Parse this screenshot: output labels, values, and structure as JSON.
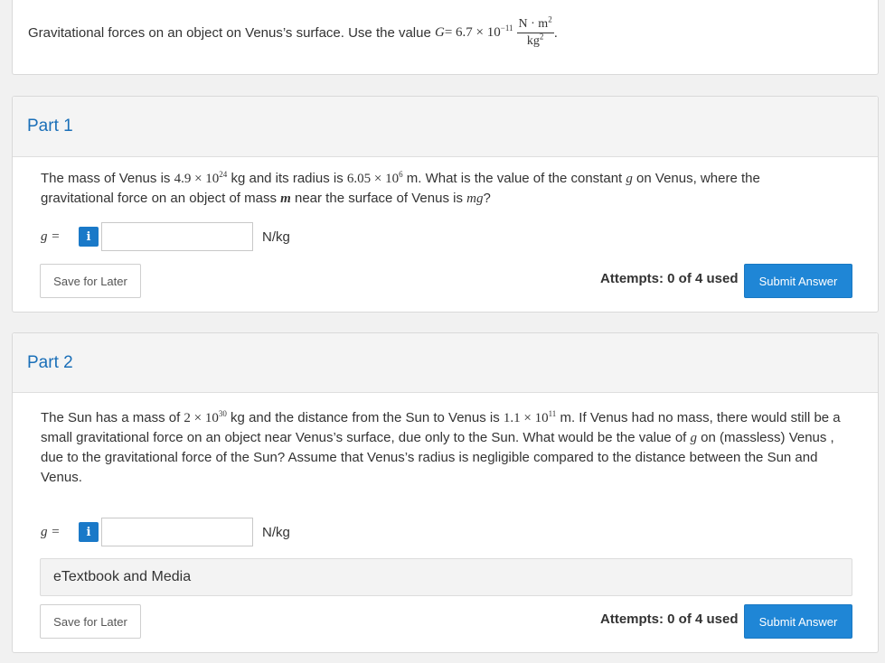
{
  "intro": {
    "text": "Gravitational forces on an object on Venus’s surface. Use the value",
    "G_symbol": "G",
    "equals": " = 6.7 × 10",
    "exp": "−11",
    "unit_num": "N · m",
    "unit_num_exp": "2",
    "unit_den": "kg",
    "unit_den_exp": "2",
    "period": "."
  },
  "part1": {
    "title": "Part 1",
    "q_a": "The mass of Venus is ",
    "mass": "4.9 × 10",
    "mass_exp": "24",
    "q_b": " kg and its radius is ",
    "radius": "6.05 × 10",
    "radius_exp": "6",
    "q_c": " m. What is the value of the constant ",
    "g": "g",
    "q_d": " on Venus, where the gravitational force on an object of mass ",
    "m": "m",
    "q_e": " near the surface of Venus is ",
    "mg": "mg",
    "q_f": "?",
    "g_label": "g =",
    "info": "i",
    "unit": "N/kg",
    "save_label": "Save for Later",
    "attempts": "Attempts: 0 of 4 used",
    "submit_label": "Submit Answer"
  },
  "part2": {
    "title": "Part 2",
    "q_a": "The Sun has a mass of ",
    "sun_mass": "2 × 10",
    "sun_mass_exp": "30",
    "q_b": " kg and the distance from the Sun to Venus is ",
    "dist": "1.1 × 10",
    "dist_exp": "11",
    "q_c": " m. If Venus had no mass, there would still be a small gravitational force on an object near Venus’s surface, due only to the Sun. What would be the value of ",
    "g": "g",
    "q_d": " on (massless) Venus , due to the gravitational force of the Sun? Assume that Venus’s radius is negligible compared to the distance between the Sun and Venus.",
    "g_label": "g =",
    "info": "i",
    "unit": "N/kg",
    "etextbook": "eTextbook and Media",
    "save_label": "Save for Later",
    "attempts": "Attempts: 0 of 4 used",
    "submit_label": "Submit Answer"
  },
  "colors": {
    "accent": "#1f86d6",
    "part_title": "#1a6fb8",
    "background": "#f1f1f1"
  }
}
